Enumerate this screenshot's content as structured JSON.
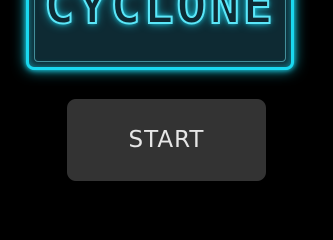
{
  "logo": {
    "title": "CYCLONE",
    "glow_color": "#1ad8f0"
  },
  "menu": {
    "start_label": "START"
  }
}
